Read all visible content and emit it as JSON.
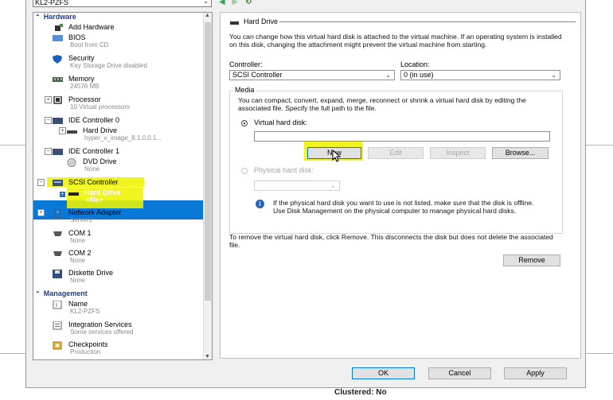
{
  "header": {
    "vm_name": "KL2-PZFS"
  },
  "tree": {
    "hardware_section": "Hardware",
    "items": [
      {
        "label": "Add Hardware",
        "sub": ""
      },
      {
        "label": "BIOS",
        "sub": "Boot from CD"
      },
      {
        "label": "Security",
        "sub": "Key Storage Drive disabled"
      },
      {
        "label": "Memory",
        "sub": "24576 MB"
      },
      {
        "label": "Processor",
        "sub": "10 Virtual processors"
      },
      {
        "label": "IDE Controller 0",
        "sub": ""
      },
      {
        "label": "Hard Drive",
        "sub": "hyper_v_image_8.1.0.0.1..."
      },
      {
        "label": "IDE Controller 1",
        "sub": ""
      },
      {
        "label": "DVD Drive",
        "sub": "None"
      },
      {
        "label": "SCSI Controller",
        "sub": ""
      },
      {
        "label": "Hard Drive",
        "sub": "<file>"
      },
      {
        "label": "Network Adapter",
        "sub": "Servers"
      },
      {
        "label": "COM 1",
        "sub": "None"
      },
      {
        "label": "COM 2",
        "sub": "None"
      },
      {
        "label": "Diskette Drive",
        "sub": "None"
      }
    ],
    "management_section": "Management",
    "mgmt_items": [
      {
        "label": "Name",
        "sub": "KL2-PZFS"
      },
      {
        "label": "Integration Services",
        "sub": "Some services offered"
      },
      {
        "label": "Checkpoints",
        "sub": "Production"
      }
    ]
  },
  "panel": {
    "title": "Hard Drive",
    "intro": "You can change how this virtual hard disk is attached to the virtual machine. If an operating system is installed on this disk, changing the attachment might prevent the virtual machine from starting.",
    "controller_label": "Controller:",
    "controller_value": "SCSI Controller",
    "location_label": "Location:",
    "location_value": "0 (in use)",
    "media_title": "Media",
    "media_text": "You can compact, convert, expand, merge, reconnect or shrink a virtual hard disk by editing the associated file. Specify the full path to the file.",
    "vhd_option": "Virtual hard disk:",
    "vhd_path": "",
    "btn_new": "New",
    "btn_edit": "Edit",
    "btn_inspect": "Inspect",
    "btn_browse": "Browse...",
    "phys_option": "Physical hard disk:",
    "phys_info": "If the physical hard disk you want to use is not listed, make sure that the disk is offline. Use Disk Management on the physical computer to manage physical hard disks.",
    "remove_text": "To remove the virtual hard disk, click Remove. This disconnects the disk but does not delete the associated file.",
    "btn_remove": "Remove"
  },
  "footer": {
    "ok": "OK",
    "cancel": "Cancel",
    "apply": "Apply"
  },
  "background": {
    "caption": "Clustered: No"
  },
  "colors": {
    "selection": "#0a78d7",
    "highlight": "#eef200",
    "section_blue": "#1a3c8f"
  }
}
